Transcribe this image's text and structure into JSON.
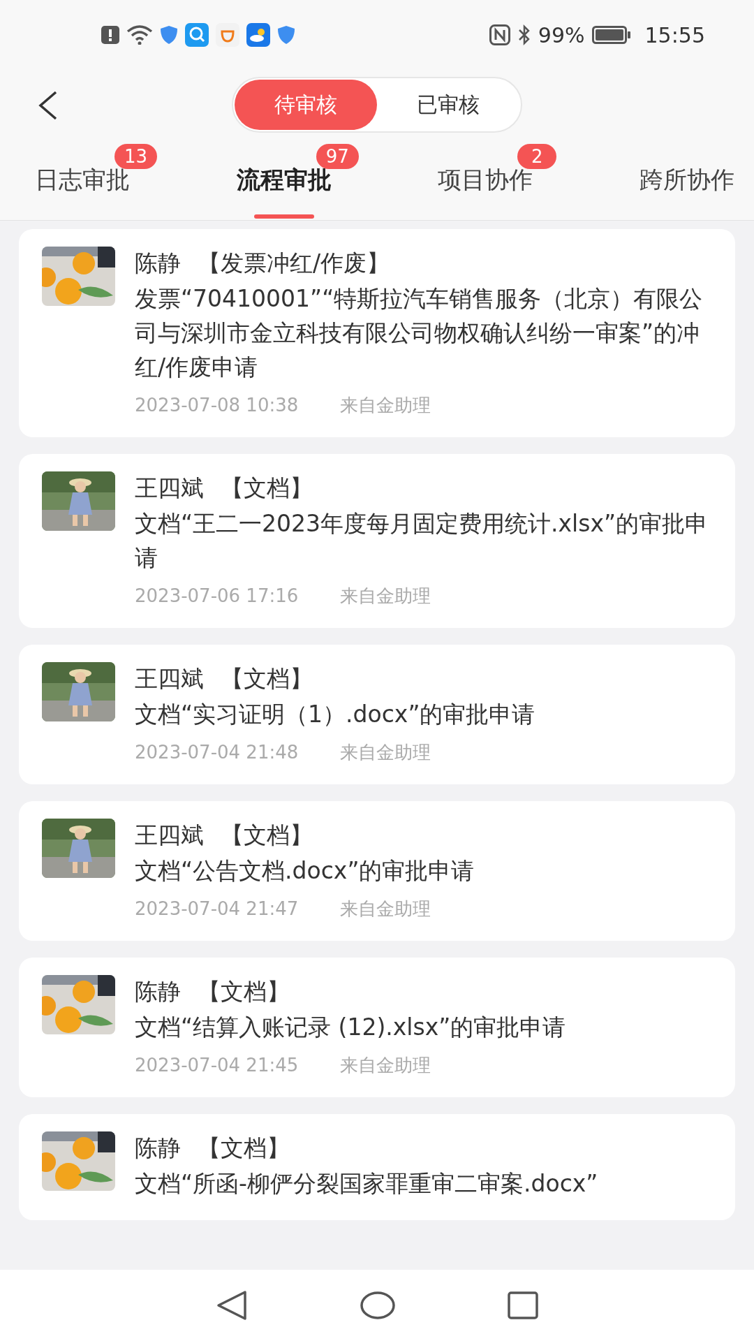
{
  "status_bar": {
    "battery": "99%",
    "time": "15:55"
  },
  "segments": [
    {
      "label": "待审核",
      "selected": true
    },
    {
      "label": "已审核",
      "selected": false
    }
  ],
  "tabs": [
    {
      "label": "日志审批",
      "badge": "13",
      "selected": false
    },
    {
      "label": "流程审批",
      "badge": "97",
      "selected": true
    },
    {
      "label": "项目协作",
      "badge": "2",
      "selected": false
    },
    {
      "label": "跨所协作",
      "selected": false
    }
  ],
  "items": [
    {
      "name": "陈静",
      "category": "【发票冲红/作废】",
      "body": "发票“70410001”“特斯拉汽车销售服务（北京）有限公司与深圳市金立科技有限公司物权确认纠纷一审案”的冲红/作废申请",
      "time": "2023-07-08 10:38",
      "source": "来自金助理"
    },
    {
      "name": "王四斌",
      "category": "【文档】",
      "body": "文档“王二一2023年度每月固定费用统计.xlsx”的审批申请",
      "time": "2023-07-06 17:16",
      "source": "来自金助理"
    },
    {
      "name": "王四斌",
      "category": "【文档】",
      "body": "文档“实习证明（1）.docx”的审批申请",
      "time": "2023-07-04 21:48",
      "source": "来自金助理"
    },
    {
      "name": "王四斌",
      "category": "【文档】",
      "body": "文档“公告文档.docx”的审批申请",
      "time": "2023-07-04 21:47",
      "source": "来自金助理"
    },
    {
      "name": "陈静",
      "category": "【文档】",
      "body": "文档“结算入账记录 (12).xlsx”的审批申请",
      "time": "2023-07-04 21:45",
      "source": "来自金助理"
    },
    {
      "name": "陈静",
      "category": "【文档】",
      "body": "文档“所函-柳俨分裂国家罪重审二审案.docx”"
    }
  ]
}
